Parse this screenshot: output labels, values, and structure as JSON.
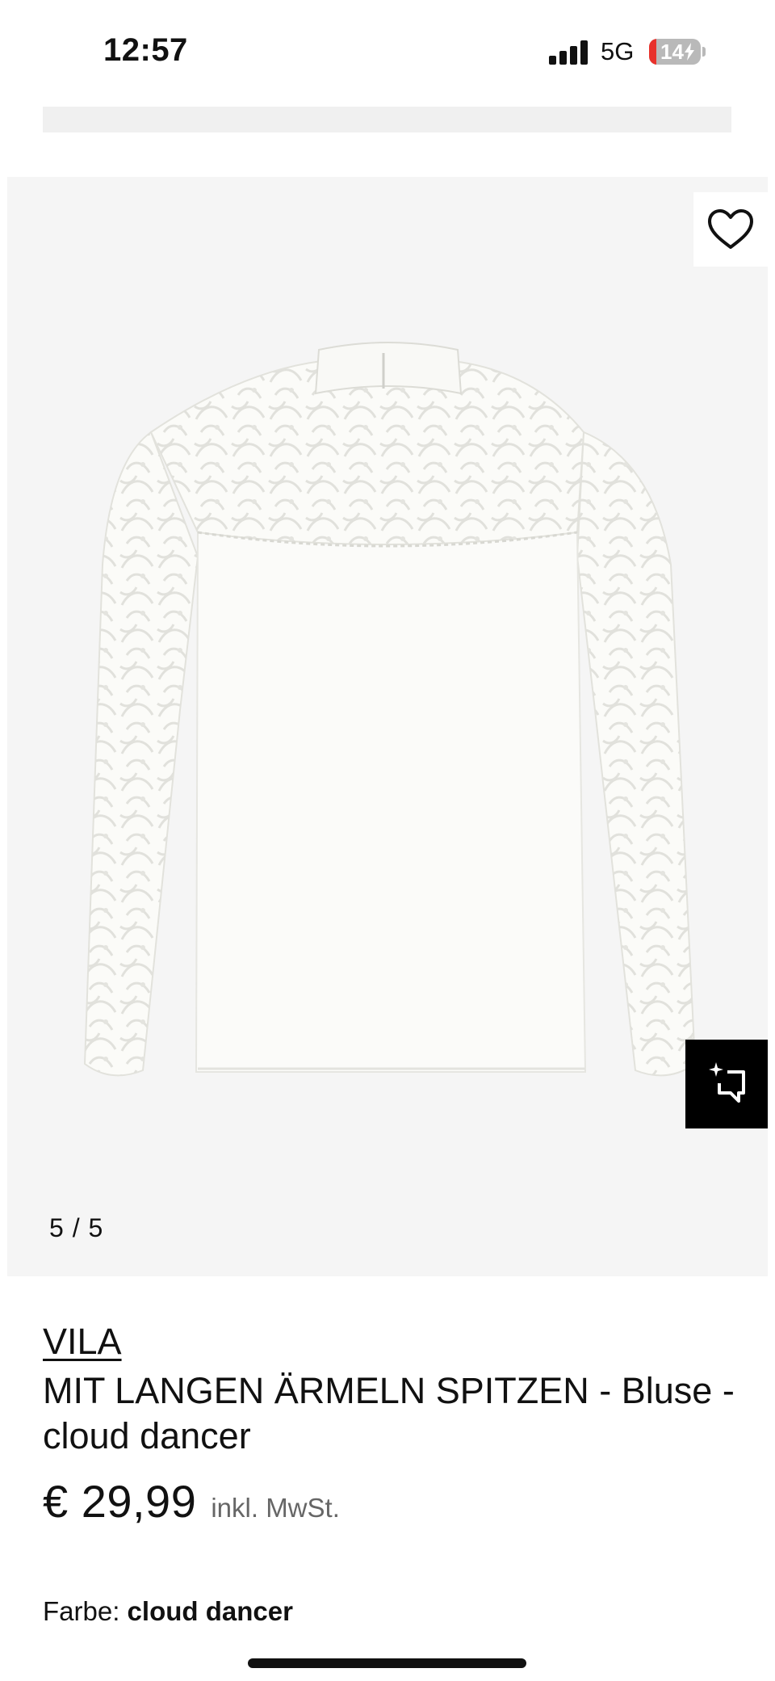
{
  "status_bar": {
    "time": "12:57",
    "network": "5G",
    "battery": "14",
    "battery_level": 0.14,
    "icons": [
      "signal-icon",
      "battery-icon",
      "charging-icon"
    ]
  },
  "gallery": {
    "counter": "5 / 5",
    "current_image": 5,
    "total_images": 5,
    "icons": [
      "heart-icon",
      "similar-items-icon"
    ]
  },
  "product": {
    "brand": "VILA",
    "name": "MIT LANGEN ÄRMELN SPITZEN - Bluse - cloud dancer",
    "price": "€ 29,99",
    "price_note": "inkl. MwSt.",
    "color_label": "Farbe:",
    "color_value": "cloud dancer"
  },
  "colors": {
    "gallery_background": "#f5f5f5",
    "accent": "#000000",
    "battery_low": "#e8312b"
  }
}
